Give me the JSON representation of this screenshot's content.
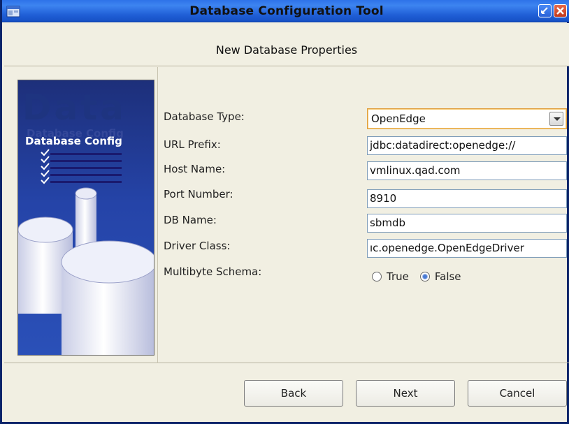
{
  "window": {
    "title": "Database Configuration Tool"
  },
  "header": {
    "title": "New Database Properties"
  },
  "banner": {
    "big_text": "Data",
    "ghost_text": "Database Config",
    "caption": "Database Config"
  },
  "form": {
    "database_type": {
      "label": "Database Type:",
      "value": "OpenEdge"
    },
    "url_prefix": {
      "label": "URL Prefix:",
      "value": "jdbc:datadirect:openedge://"
    },
    "host_name": {
      "label": "Host Name:",
      "value": "vmlinux.qad.com"
    },
    "port_number": {
      "label": "Port Number:",
      "value": "8910"
    },
    "db_name": {
      "label": "DB Name:",
      "value": "sbmdb"
    },
    "driver_class": {
      "label": "Driver Class:",
      "value": "ıc.openedge.OpenEdgeDriver"
    },
    "multibyte_schema": {
      "label": "Multibyte Schema:",
      "options": [
        {
          "label": "True",
          "selected": false
        },
        {
          "label": "False",
          "selected": true
        }
      ]
    }
  },
  "buttons": {
    "back": "Back",
    "next": "Next",
    "cancel": "Cancel"
  },
  "colors": {
    "titlebar": "#2e73e8",
    "window_bg": "#f1efe2",
    "banner_bg": "#2544a8",
    "select_focus": "#e0a040"
  },
  "icons": {
    "app": "app-window-icon",
    "minimize": "minimize-icon",
    "close": "close-icon",
    "dropdown": "chevron-down-icon"
  }
}
